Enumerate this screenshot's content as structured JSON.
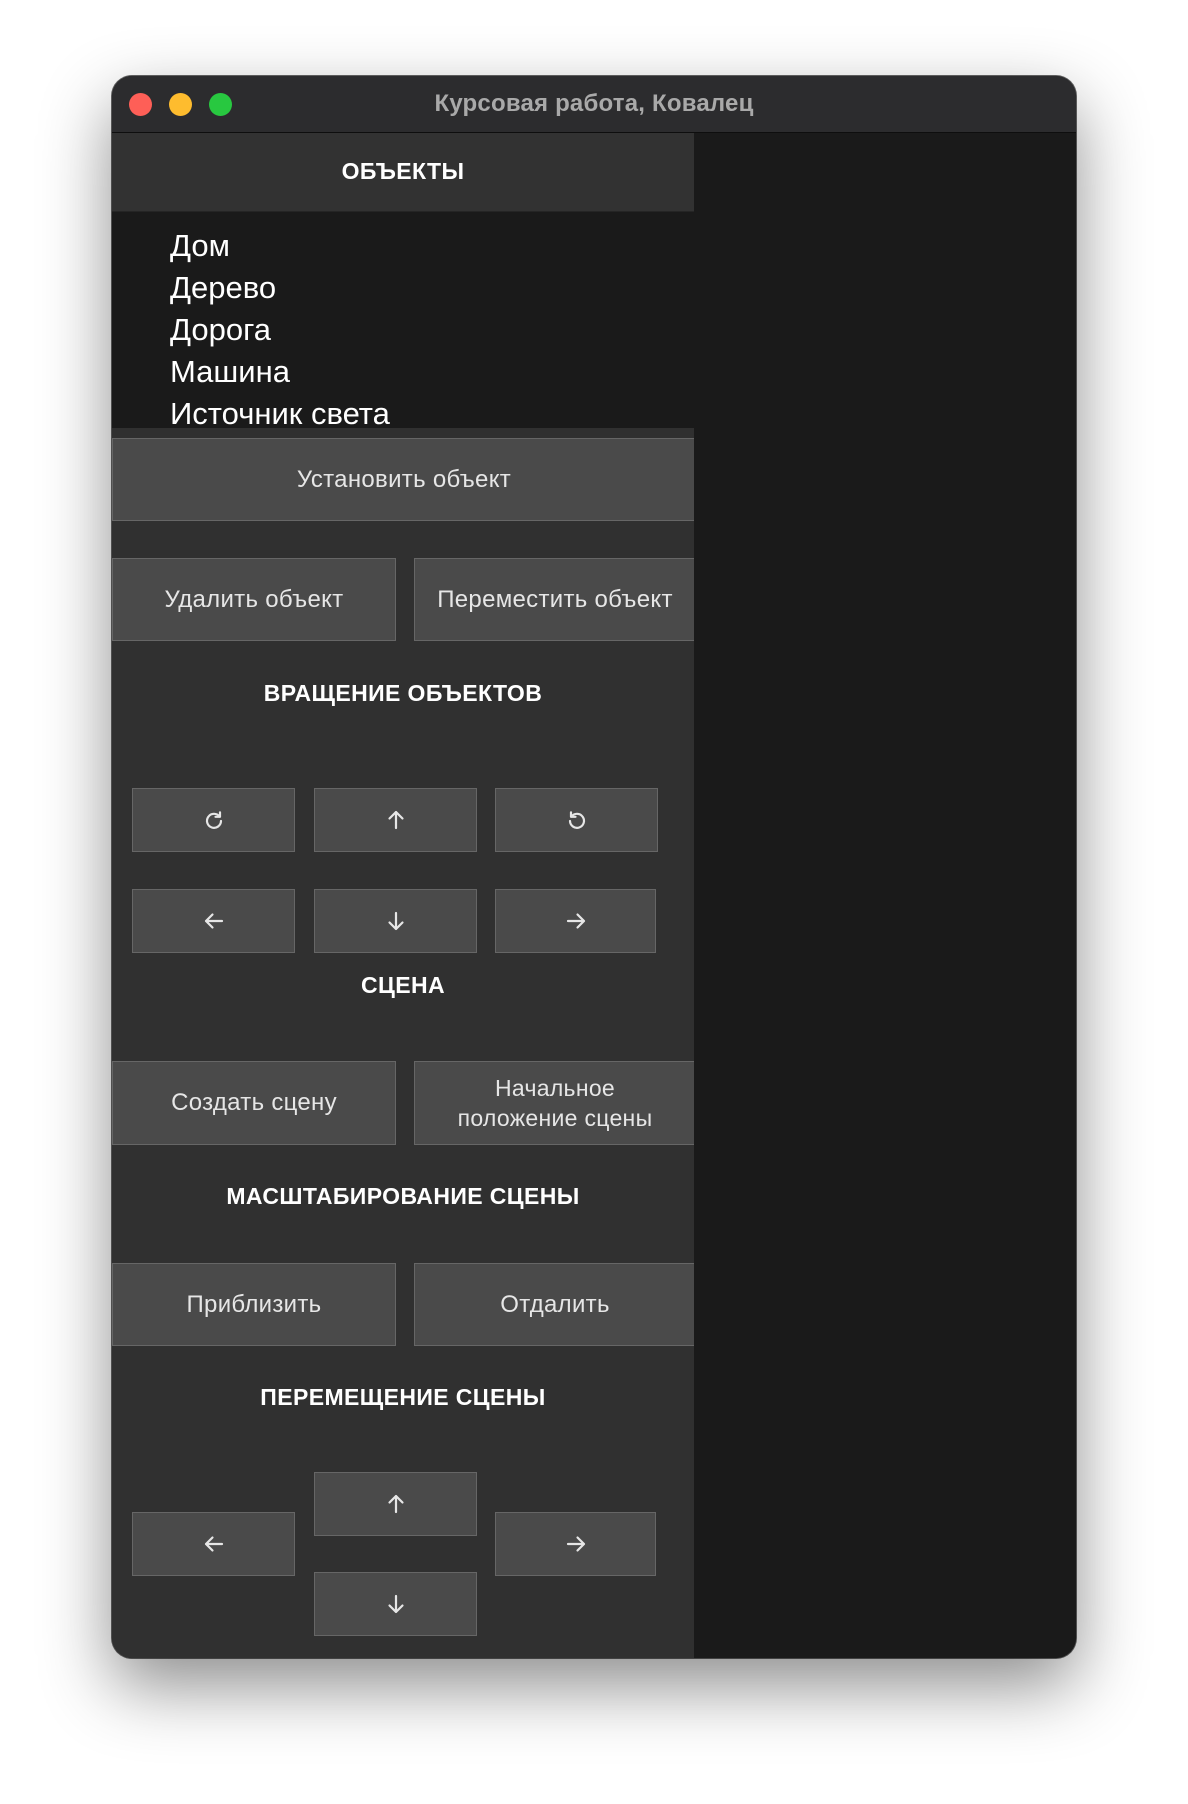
{
  "window": {
    "title": "Курсовая работа, Ковалец"
  },
  "objects": {
    "heading": "ОБЪЕКТЫ",
    "items": [
      "Дом",
      "Дерево",
      "Дорога",
      "Машина",
      "Источник света"
    ],
    "install_button": "Установить объект",
    "delete_button": "Удалить объект",
    "move_button": "Переместить объект"
  },
  "rotation": {
    "heading": "ВРАЩЕНИЕ ОБЪЕКТОВ",
    "buttons": [
      "rotate-clockwise-icon",
      "arrow-up-icon",
      "rotate-counterclockwise-icon",
      "arrow-left-icon",
      "arrow-down-icon",
      "arrow-right-icon"
    ]
  },
  "scene": {
    "heading": "СЦЕНА",
    "create_button": "Создать сцену",
    "reset_button_line1": "Начальное",
    "reset_button_line2": "положение сцены"
  },
  "scaling": {
    "heading": "МАСШТАБИРОВАНИЕ СЦЕНЫ",
    "zoom_in_button": "Приблизить",
    "zoom_out_button": "Отдалить"
  },
  "panning": {
    "heading": "ПЕРЕМЕЩЕНИЕ СЦЕНЫ",
    "buttons": [
      "arrow-up-icon",
      "arrow-left-icon",
      "arrow-right-icon",
      "arrow-down-icon"
    ]
  },
  "colors": {
    "panel": "#303030",
    "button": "#4a4a4a",
    "canvas": "#1a1a1a",
    "close": "#fe5f57",
    "minimize": "#febc2e",
    "maximize": "#28c840"
  }
}
